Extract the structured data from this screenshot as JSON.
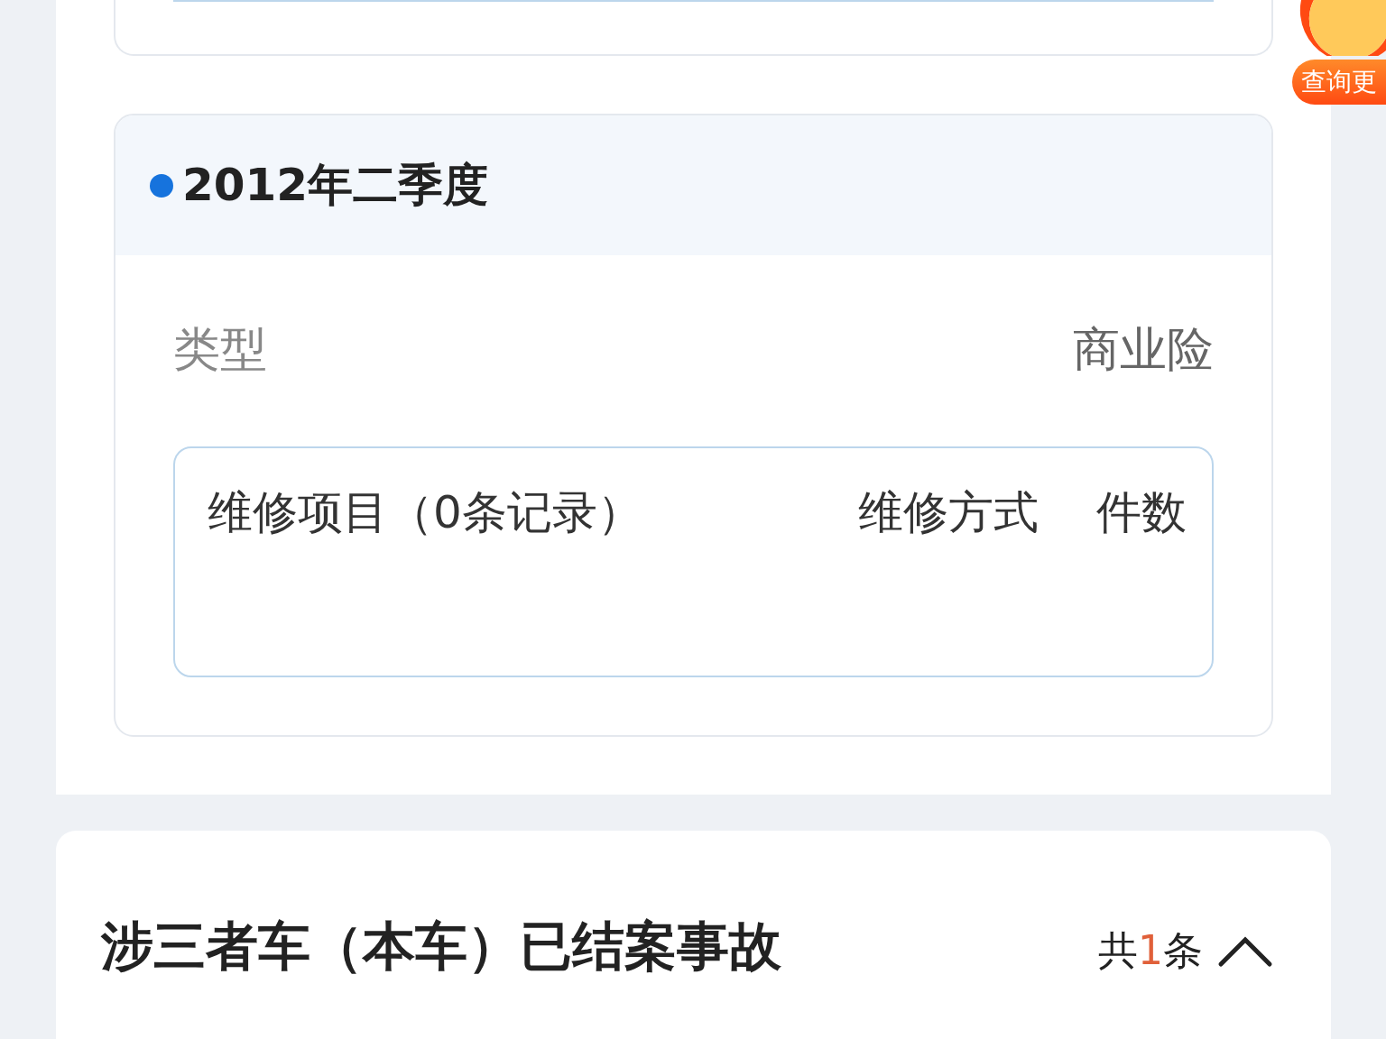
{
  "float_badge": {
    "label": "查询更"
  },
  "quarter_card": {
    "title": "2012年二季度",
    "type_label": "类型",
    "type_value": "商业险",
    "table": {
      "columns": [
        "维修项目（0条记录）",
        "维修方式",
        "件数"
      ]
    }
  },
  "section": {
    "title": "涉三者车（本车）已结案事故",
    "count_prefix": "共",
    "count": "1",
    "count_suffix": "条",
    "expanded": true
  }
}
